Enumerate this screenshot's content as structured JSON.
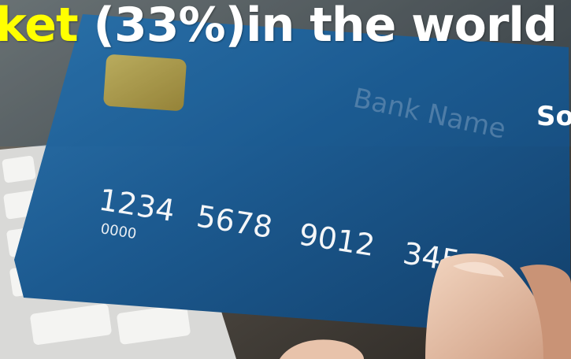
{
  "headline": {
    "highlight": "ket",
    "rest": " (33%)in the world"
  },
  "source_label": "So",
  "card": {
    "bank_name": "Bank Name",
    "number_groups": [
      "1234",
      "5678",
      "9012",
      "345"
    ],
    "sub_number": "0000"
  },
  "colors": {
    "highlight_text": "#ffff00",
    "headline_text": "#ffffff",
    "card_blue": "#1c5a90",
    "chip_gold": "#c9a435",
    "band_overlay": "#1d5f96"
  }
}
